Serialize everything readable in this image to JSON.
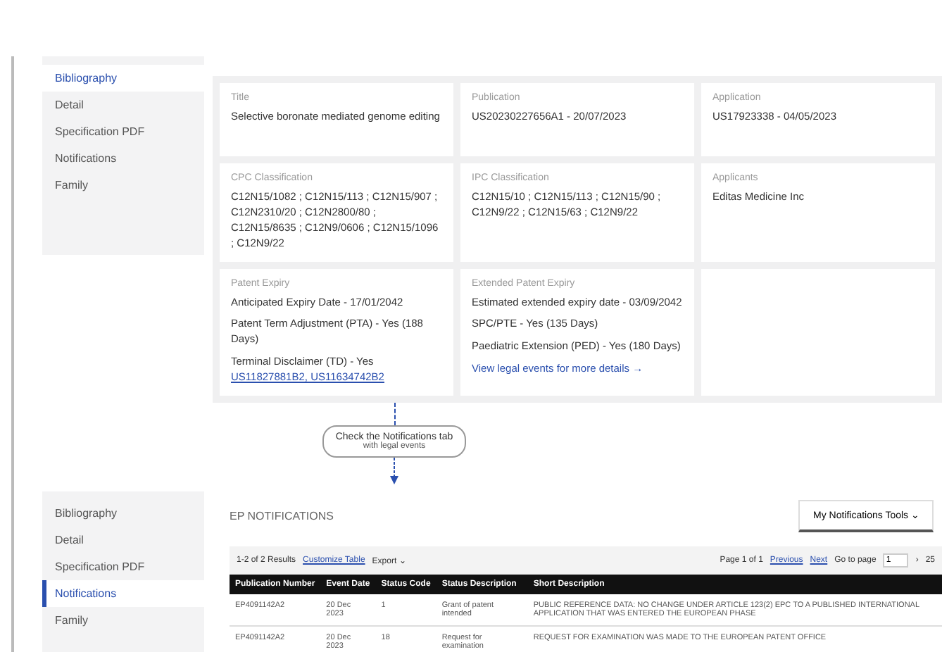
{
  "top_sidebar": {
    "items": [
      {
        "label": "Bibliography",
        "selected": true
      },
      {
        "label": "Detail",
        "selected": false
      },
      {
        "label": "Specification PDF",
        "selected": false
      },
      {
        "label": "Notifications",
        "selected": false
      },
      {
        "label": "Family",
        "selected": false
      }
    ]
  },
  "cards": [
    {
      "kind": "text",
      "label": "Title",
      "value": "Selective boronate mediated genome editing"
    },
    {
      "kind": "text",
      "label": "Publication",
      "value": "US20230227656A1 - 20/07/2023"
    },
    {
      "kind": "text",
      "label": "Application",
      "value": "US17923338 - 04/05/2023"
    },
    {
      "kind": "text",
      "label": "CPC Classification",
      "value": "C12N15/1082 ; C12N15/113 ; C12N15/907 ; C12N2310/20 ; C12N2800/80 ; C12N15/8635 ; C12N9/0606 ; C12N15/1096 ; C12N9/22"
    },
    {
      "kind": "text",
      "label": "IPC Classification",
      "value": "C12N15/10 ; C12N15/113 ; C12N15/90 ; C12N9/22 ; C12N15/63 ; C12N9/22"
    },
    {
      "kind": "text",
      "label": "Applicants",
      "value": "Editas Medicine Inc"
    },
    {
      "kind": "lines",
      "label": "Patent Expiry",
      "lines": [
        "Anticipated Expiry Date - 17/01/2042",
        "Patent Term Adjustment (PTA) - Yes (188 Days)"
      ],
      "tail": "Terminal Disclaimer (TD) - Yes ",
      "link": "US11827881B2, US11634742B2"
    },
    {
      "kind": "lines",
      "label": "Extended Patent Expiry",
      "lines": [
        "Estimated extended expiry date - 03/09/2042",
        "SPC/PTE - Yes (135 Days)",
        "Paediatric Extension (PED) - Yes (180 Days)"
      ],
      "more": "View legal events for more details →"
    },
    {
      "kind": "empty"
    }
  ],
  "callout": {
    "text": "Check the Notifications tab",
    "subtext": "with legal events"
  },
  "bottom_sidebar": {
    "items": [
      {
        "label": "Bibliography",
        "selected": false
      },
      {
        "label": "Detail",
        "selected": false
      },
      {
        "label": "Specification PDF",
        "selected": false
      },
      {
        "label": "Notifications",
        "selected": true
      },
      {
        "label": "Family",
        "selected": false
      }
    ]
  },
  "notifications": {
    "title": "EP NOTIFICATIONS",
    "tools_button": "My Notifications Tools ⌄",
    "results": "1-2 of 2 Results",
    "customize": "Customize Table",
    "export": "Export ⌄",
    "pager": {
      "page": "Page 1 of 1",
      "previous": "Previous",
      "next": "Next",
      "goto": "Go to page",
      "page_value": "1",
      "go": "›",
      "per_page": "25"
    },
    "table": {
      "columns": [
        "Publication Number",
        "Event Date",
        "Status Code",
        "Status Description",
        "Short Description"
      ],
      "rows": [
        [
          "EP4091142A2",
          "20 Dec 2023",
          "1",
          "Grant of patent intended",
          "PUBLIC REFERENCE DATA: NO CHANGE UNDER ARTICLE 123(2) EPC TO A PUBLISHED INTERNATIONAL APPLICATION THAT WAS ENTERED THE EUROPEAN PHASE"
        ],
        [
          "EP4091142A2",
          "20 Dec 2023",
          "18",
          "Request for examination",
          "REQUEST FOR EXAMINATION WAS MADE TO THE EUROPEAN PATENT OFFICE"
        ]
      ]
    }
  }
}
